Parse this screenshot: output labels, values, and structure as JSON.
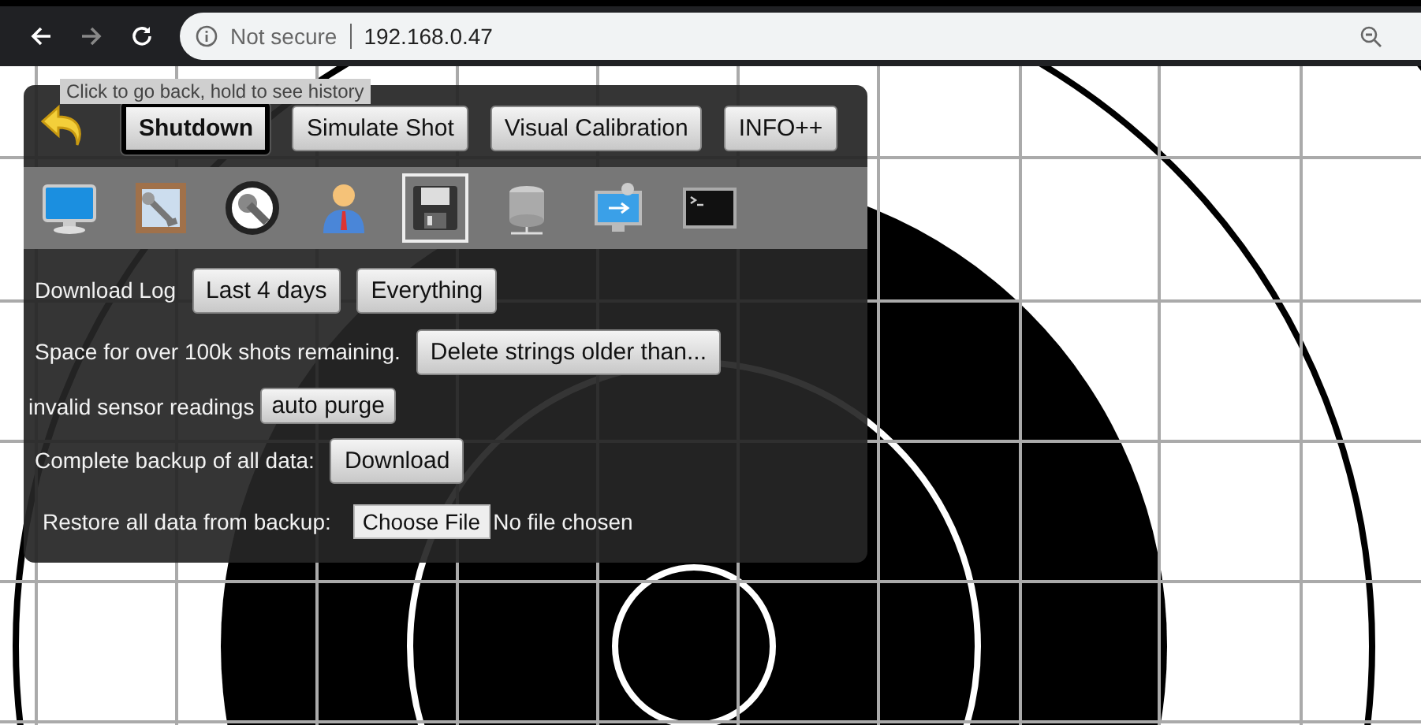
{
  "browser": {
    "security": "Not secure",
    "url": "192.168.0.47"
  },
  "tooltip": "Click to go back, hold to see history",
  "top_buttons": [
    {
      "label": "Shutdown",
      "focused": true
    },
    {
      "label": "Simulate Shot",
      "focused": false
    },
    {
      "label": "Visual Calibration",
      "focused": false
    },
    {
      "label": "INFO++",
      "focused": false
    }
  ],
  "tool_icons": [
    {
      "kind": "monitor",
      "selected": false
    },
    {
      "kind": "frame-wrench",
      "selected": false
    },
    {
      "kind": "circle-wrench",
      "selected": false
    },
    {
      "kind": "user",
      "selected": false
    },
    {
      "kind": "floppy",
      "selected": true
    },
    {
      "kind": "database",
      "selected": false
    },
    {
      "kind": "usb-monitor",
      "selected": false
    },
    {
      "kind": "terminal",
      "selected": false
    }
  ],
  "rows": [
    {
      "kind": "buttons",
      "label": "Download Log",
      "buttons": [
        "Last 4 days",
        "Everything"
      ]
    },
    {
      "kind": "buttons",
      "label": "Space for over 100k shots remaining.",
      "buttons": [
        "Delete strings older than..."
      ]
    },
    {
      "kind": "compact",
      "label": "invalid sensor readings",
      "buttons": [
        "auto purge"
      ]
    },
    {
      "kind": "buttons",
      "label": "Complete backup of all data:",
      "buttons": [
        "Download"
      ]
    },
    {
      "kind": "file",
      "label": "Restore all data from backup:",
      "button": "Choose File",
      "status": "No file chosen"
    }
  ]
}
